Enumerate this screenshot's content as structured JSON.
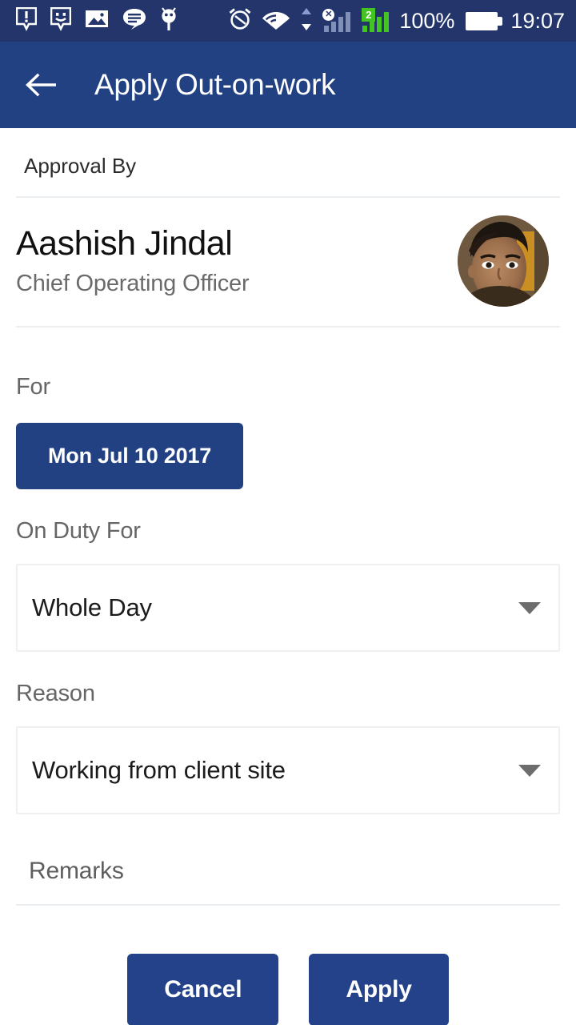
{
  "status_bar": {
    "icons_left": [
      {
        "name": "alert-notification-icon",
        "glyph": "!"
      },
      {
        "name": "smiley-notification-icon",
        "glyph": ":)"
      },
      {
        "name": "gallery-image-icon",
        "glyph": "image"
      },
      {
        "name": "message-chat-icon",
        "glyph": "chat"
      },
      {
        "name": "android-debug-icon",
        "glyph": "android"
      }
    ],
    "icons_right": [
      {
        "name": "alarm-clock-icon"
      },
      {
        "name": "wifi-icon"
      },
      {
        "name": "data-transfer-arrows-icon"
      },
      {
        "name": "signal-sim1-no-service-icon"
      },
      {
        "name": "signal-sim2-icon"
      }
    ],
    "sim2_badge": "2",
    "battery_percent": "100%",
    "time": "19:07"
  },
  "app_bar": {
    "back_label": "back-arrow",
    "title": "Apply Out-on-work"
  },
  "approval": {
    "section_label": "Approval By",
    "name": "Aashish Jindal",
    "role": "Chief Operating Officer",
    "avatar_alt": "Aashish Jindal profile photo"
  },
  "form": {
    "for": {
      "label": "For",
      "date_value": "Mon Jul 10 2017"
    },
    "on_duty_for": {
      "label": "On Duty For",
      "value": "Whole Day",
      "options": [
        "Whole Day"
      ]
    },
    "reason": {
      "label": "Reason",
      "value": "Working from client site",
      "options": [
        "Working from client site"
      ]
    },
    "remarks": {
      "placeholder": "Remarks",
      "value": ""
    }
  },
  "actions": {
    "cancel_label": "Cancel",
    "apply_label": "Apply"
  },
  "colors": {
    "status_bar": "#23356b",
    "app_bar": "#224183",
    "primary_button": "#234289",
    "sim2_badge_green": "#44c422",
    "divider": "#eceff1",
    "label_gray": "#666666"
  }
}
